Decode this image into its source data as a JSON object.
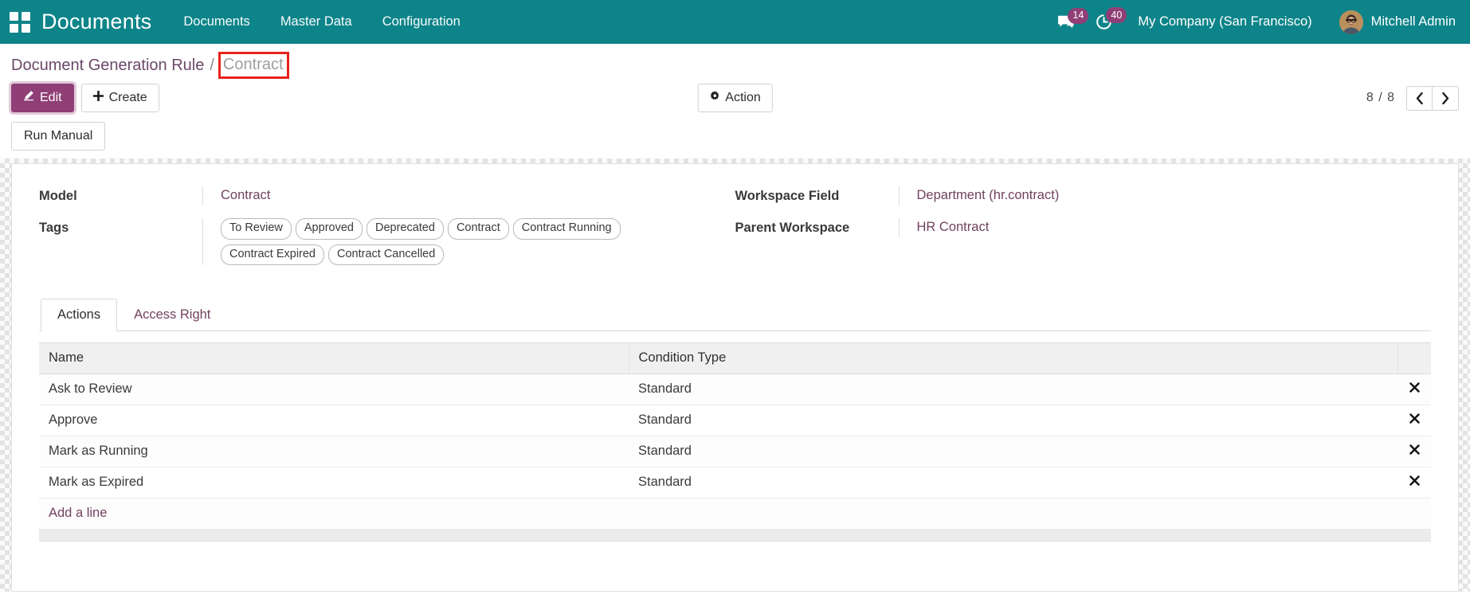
{
  "navbar": {
    "apps_icon": "apps-grid-icon",
    "brand": "Documents",
    "menu_items": [
      {
        "label": "Documents"
      },
      {
        "label": "Master Data"
      },
      {
        "label": "Configuration"
      }
    ],
    "messages": {
      "icon": "chat-bubble-icon",
      "count": "14"
    },
    "activities": {
      "icon": "clock-activity-icon",
      "count": "40"
    },
    "company": "My Company (San Francisco)",
    "user": "Mitchell Admin",
    "avatar_icon": "user-avatar",
    "background_color": "#0d8489",
    "badge_color": "#8f3f76"
  },
  "breadcrumb": {
    "root": "Document Generation Rule",
    "separator": "/",
    "current": "Contract",
    "annotation_color": "#e8221c"
  },
  "control_panel": {
    "edit_label": "Edit",
    "edit_icon": "pencil-icon",
    "create_label": "Create",
    "create_icon": "plus-icon",
    "action_label": "Action",
    "action_icon": "gear-icon",
    "pager_value": "8 / 8",
    "prev_icon": "chevron-left-icon",
    "next_icon": "chevron-right-icon",
    "primary_color": "#8f3f76"
  },
  "statusbar": {
    "run_manual_label": "Run Manual"
  },
  "form": {
    "left": [
      {
        "label": "Model",
        "value": "Contract",
        "type": "link"
      },
      {
        "label": "Tags",
        "type": "tags",
        "tags": [
          "To Review",
          "Approved",
          "Deprecated",
          "Contract",
          "Contract Running",
          "Contract Expired",
          "Contract Cancelled"
        ]
      }
    ],
    "right": [
      {
        "label": "Workspace Field",
        "value": "Department (hr.contract)",
        "type": "link"
      },
      {
        "label": "Parent Workspace",
        "value": "HR Contract",
        "type": "link"
      }
    ]
  },
  "notebook": {
    "tabs": [
      {
        "label": "Actions",
        "active": true
      },
      {
        "label": "Access Right",
        "active": false
      }
    ]
  },
  "table": {
    "columns": [
      "Name",
      "Condition Type"
    ],
    "rows": [
      {
        "name": "Ask to Review",
        "condition_type": "Standard",
        "delete_icon": "close-x-icon"
      },
      {
        "name": "Approve",
        "condition_type": "Standard",
        "delete_icon": "close-x-icon"
      },
      {
        "name": "Mark as Running",
        "condition_type": "Standard",
        "delete_icon": "close-x-icon"
      },
      {
        "name": "Mark as Expired",
        "condition_type": "Standard",
        "delete_icon": "close-x-icon"
      }
    ],
    "add_line_label": "Add a line"
  }
}
